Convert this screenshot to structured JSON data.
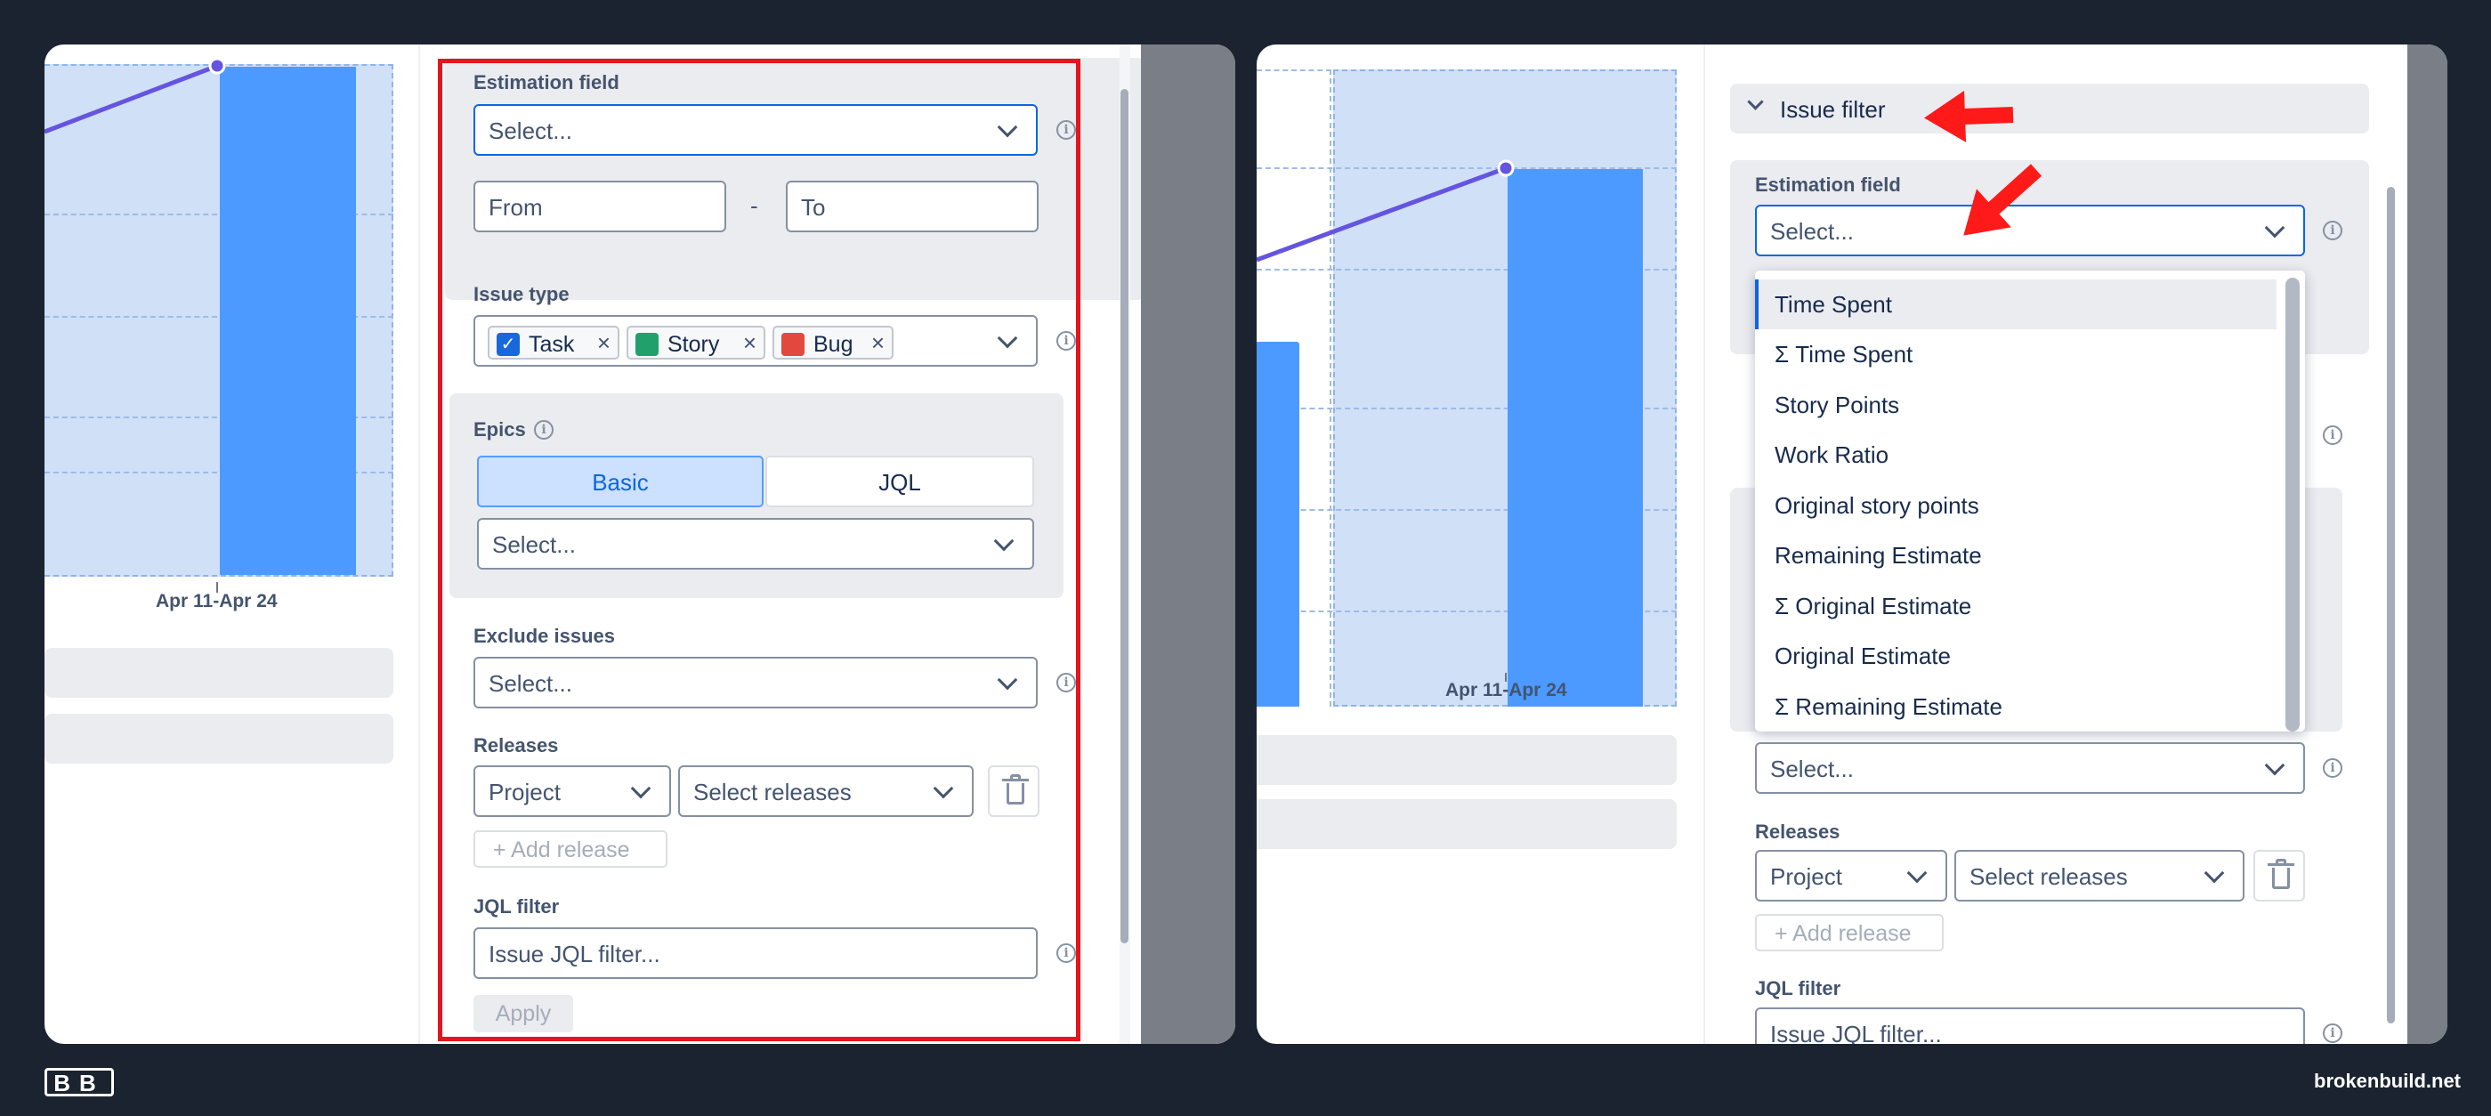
{
  "chart": {
    "x_tick_label": "Apr 11-Apr 24"
  },
  "left_form": {
    "estimation_label": "Estimation field",
    "estimation_placeholder": "Select...",
    "from_placeholder": "From",
    "range_sep": "-",
    "to_placeholder": "To",
    "issue_type_label": "Issue type",
    "issue_types": [
      {
        "label": "Task",
        "color": "#1868db",
        "icon": "checkbox-icon"
      },
      {
        "label": "Story",
        "color": "#22a06b",
        "icon": "bookmark-icon"
      },
      {
        "label": "Bug",
        "color": "#e2483d",
        "icon": "bug-icon"
      }
    ],
    "epics_label": "Epics",
    "epics_tabs": {
      "basic": "Basic",
      "jql": "JQL"
    },
    "epics_placeholder": "Select...",
    "exclude_label": "Exclude issues",
    "exclude_placeholder": "Select...",
    "releases_label": "Releases",
    "project_select": "Project",
    "releases_select": "Select releases",
    "add_release": "+ Add release",
    "jql_label": "JQL filter",
    "jql_placeholder": "Issue JQL filter...",
    "apply": "Apply"
  },
  "right_form": {
    "section_title": "Issue filter",
    "estimation_label": "Estimation field",
    "estimation_placeholder": "Select...",
    "dropdown_options": [
      "Time Spent",
      "Σ Time Spent",
      "Story Points",
      "Work Ratio",
      "Original story points",
      "Remaining Estimate",
      "Σ Original Estimate",
      "Original Estimate",
      "Σ Remaining Estimate"
    ],
    "selected_option": "Time Spent",
    "exclude_placeholder": "Select...",
    "releases_label": "Releases",
    "project_select": "Project",
    "releases_select": "Select releases",
    "add_release": "+ Add release",
    "jql_label": "JQL filter",
    "jql_placeholder": "Issue JQL filter..."
  },
  "footer": {
    "logo_text": "BB",
    "site": "brokenbuild.net"
  },
  "colors": {
    "background": "#1b2330",
    "accent": "#0c66e4",
    "bar": "#4c9aff",
    "bar_bg": "#cfe0f7",
    "trend_line": "#6554e0",
    "highlight": "#e5141e",
    "arrow": "#ff1a1a"
  }
}
